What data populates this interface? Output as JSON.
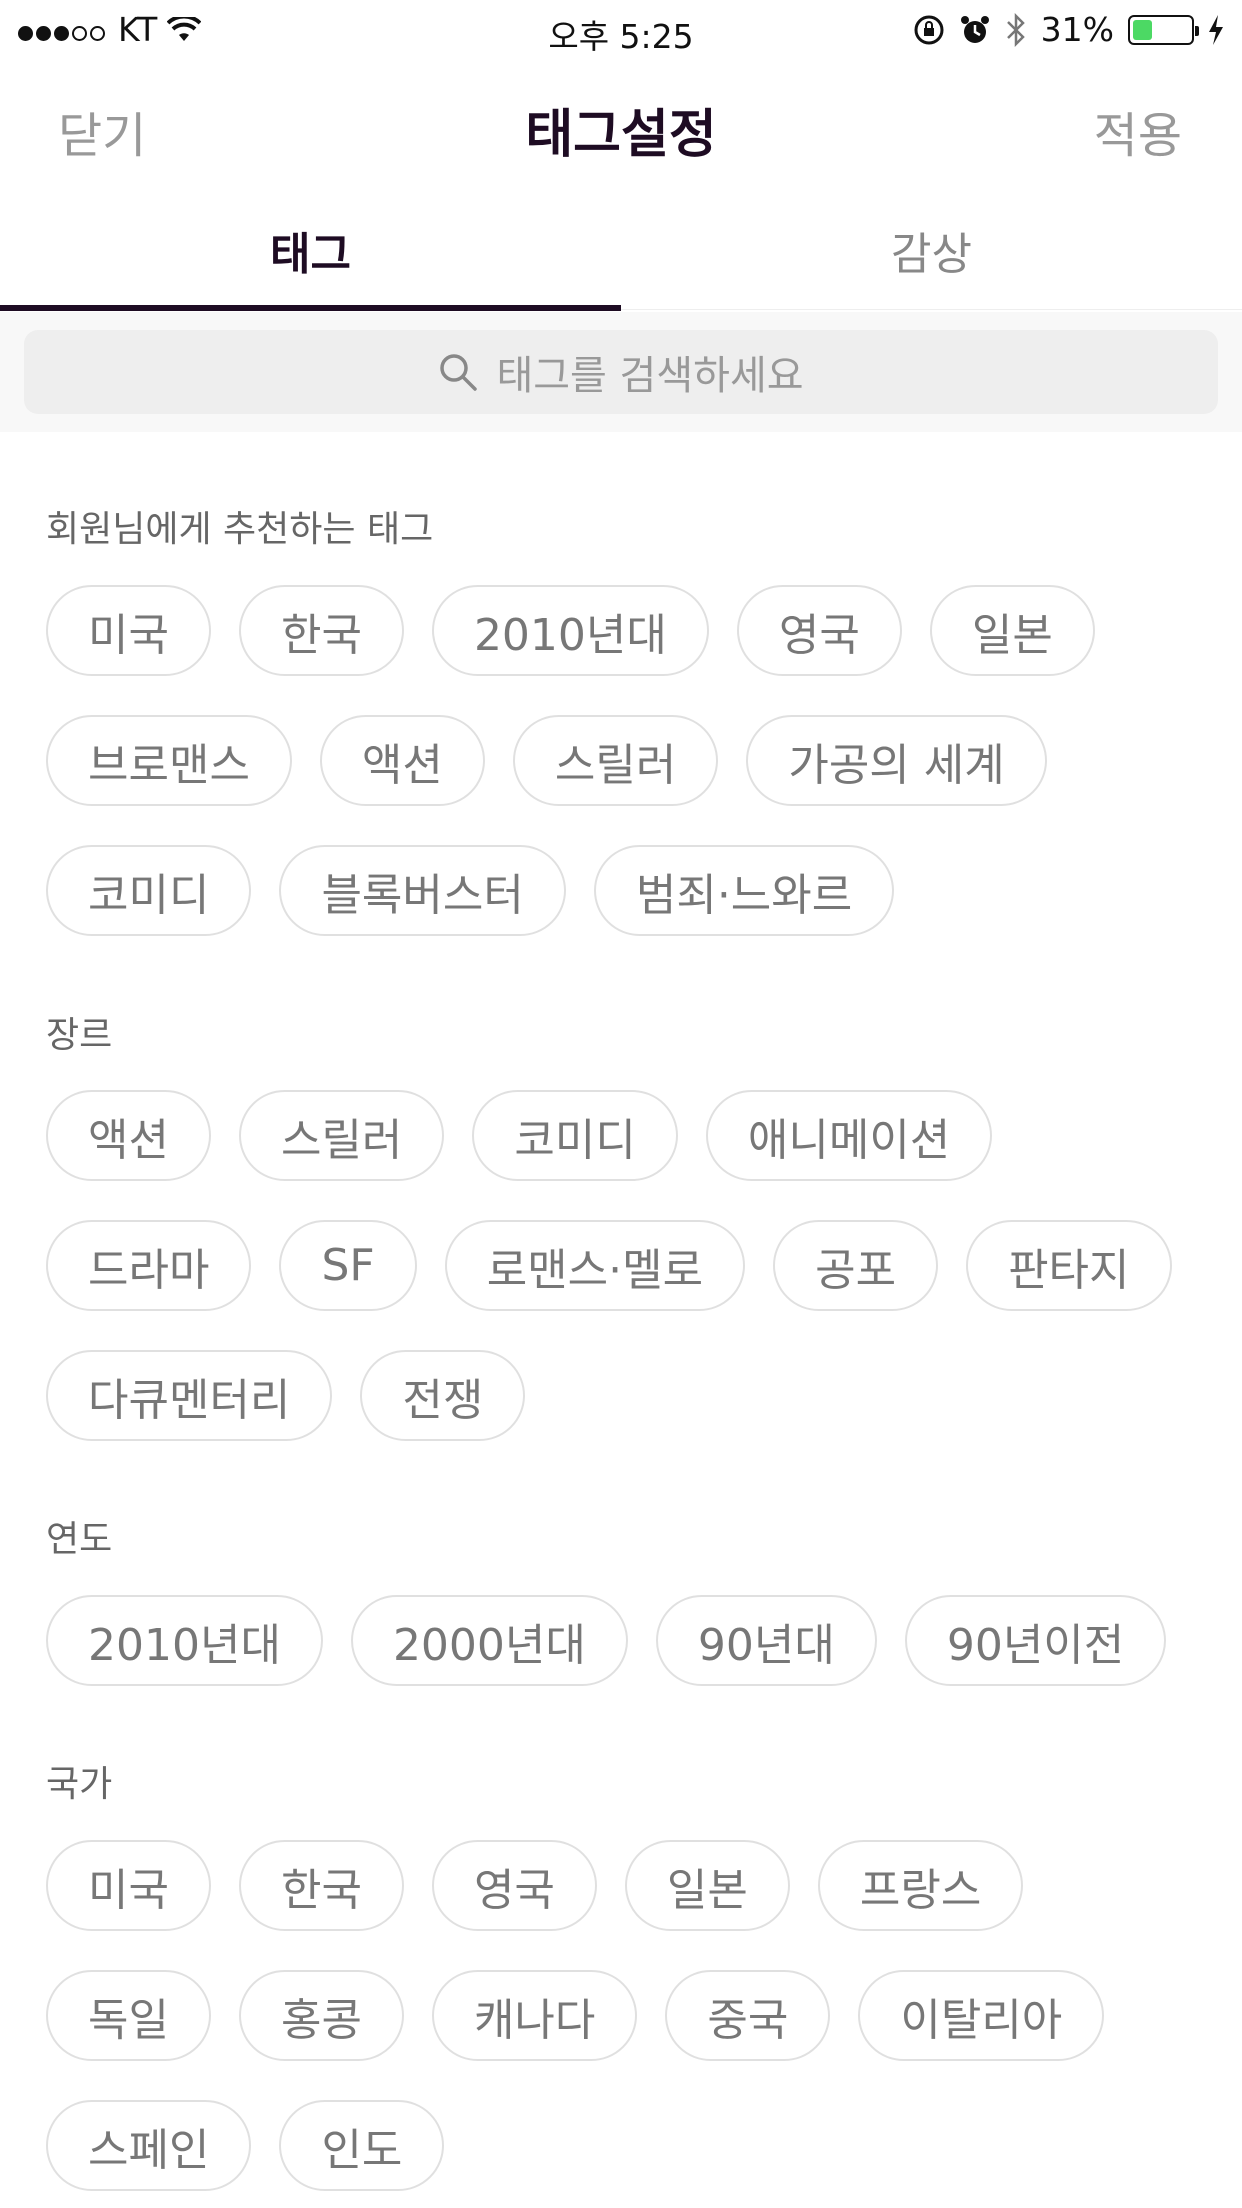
{
  "status": {
    "carrier": "KT",
    "time": "오후 5:25",
    "battery_text": "31%",
    "battery_level": 0.31,
    "signal_bars": 3
  },
  "nav": {
    "close": "닫기",
    "title": "태그설정",
    "apply": "적용"
  },
  "tabs": {
    "active": "태그",
    "inactive": "감상"
  },
  "search": {
    "placeholder": "태그를 검색하세요"
  },
  "sections": {
    "recommended": {
      "title": "회원님에게 추천하는 태그",
      "tags": [
        "미국",
        "한국",
        "2010년대",
        "영국",
        "일본",
        "브로맨스",
        "액션",
        "스릴러",
        "가공의 세계",
        "코미디",
        "블록버스터",
        "범죄·느와르"
      ]
    },
    "genre": {
      "title": "장르",
      "tags": [
        "액션",
        "스릴러",
        "코미디",
        "애니메이션",
        "드라마",
        "SF",
        "로맨스·멜로",
        "공포",
        "판타지",
        "다큐멘터리",
        "전쟁"
      ]
    },
    "year": {
      "title": "연도",
      "tags": [
        "2010년대",
        "2000년대",
        "90년대",
        "90년이전"
      ]
    },
    "country": {
      "title": "국가",
      "tags": [
        "미국",
        "한국",
        "영국",
        "일본",
        "프랑스",
        "독일",
        "홍콩",
        "캐나다",
        "중국",
        "이탈리아",
        "스페인",
        "인도"
      ]
    }
  },
  "colors": {
    "accent": "#1e0c23",
    "chip_border": "#e0e0e0",
    "chip_text": "#777777",
    "muted": "#999999",
    "battery": "#4cd964"
  }
}
